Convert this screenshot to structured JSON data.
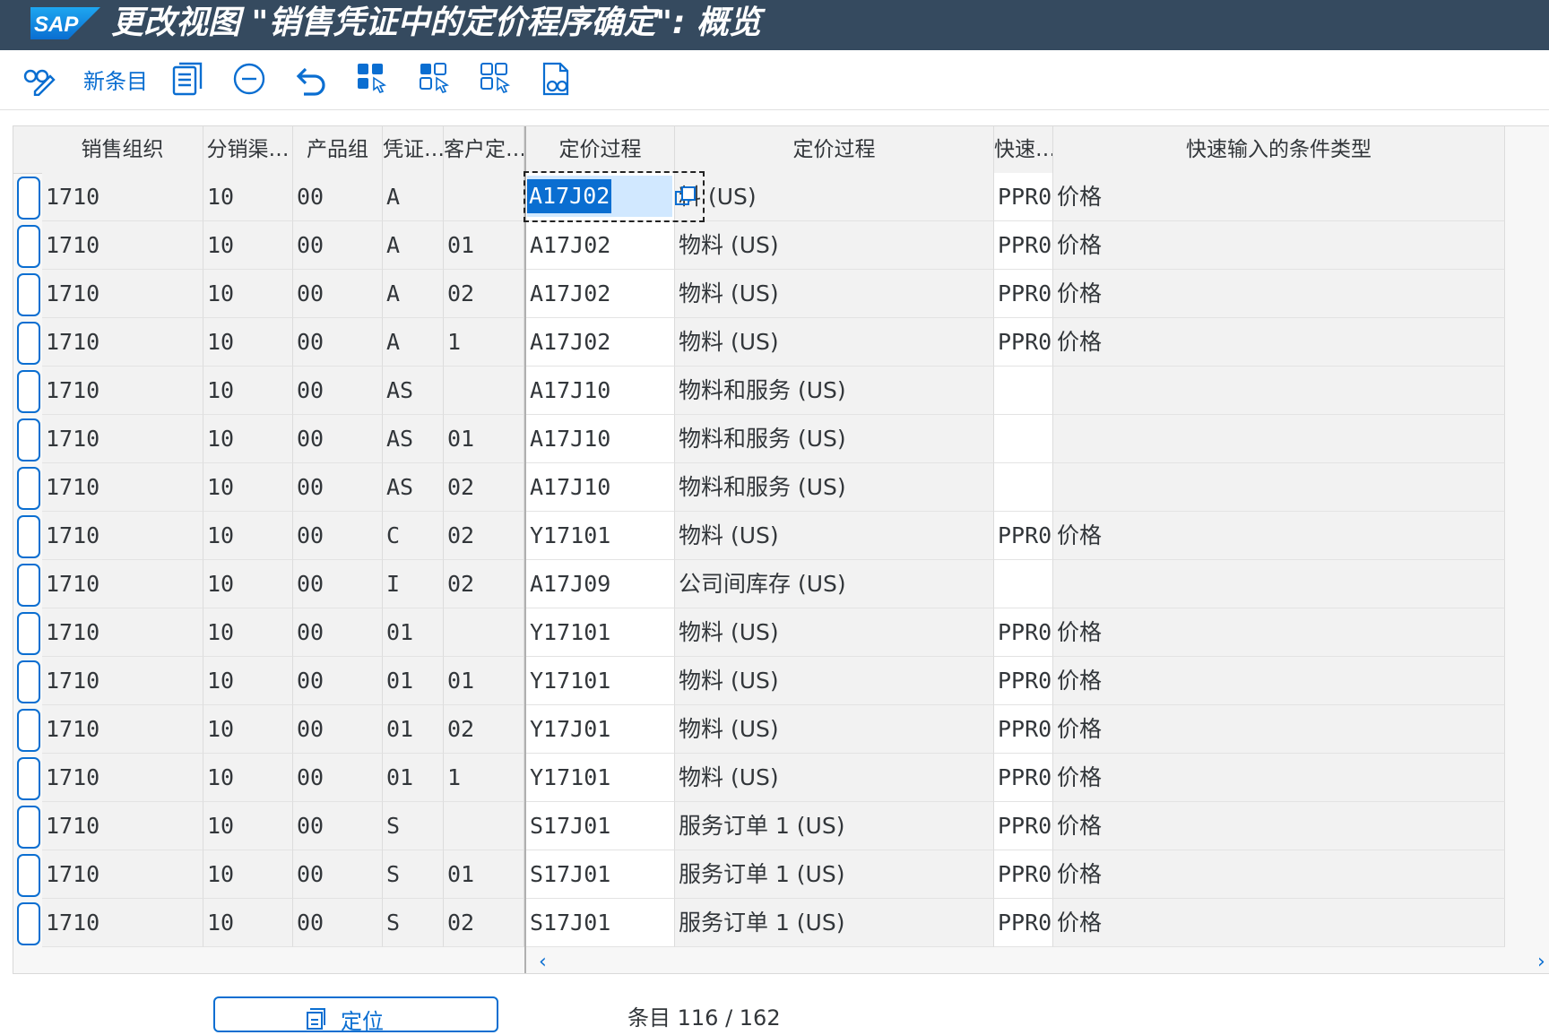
{
  "titlebar": {
    "logo_text": "SAP",
    "title": "更改视图 \"销售凭证中的定价程序确定\": 概览"
  },
  "toolbar": {
    "items": [
      {
        "name": "display-change-button",
        "icon": "glasses-pencil-icon"
      },
      {
        "name": "new-entries-button",
        "label": "新条目"
      },
      {
        "name": "copy-as-button",
        "icon": "copy-document-icon"
      },
      {
        "name": "delete-button",
        "icon": "minus-circle-icon"
      },
      {
        "name": "undo-button",
        "icon": "undo-icon"
      },
      {
        "name": "select-all-button",
        "icon": "select-all-icon"
      },
      {
        "name": "select-block-button",
        "icon": "select-block-icon"
      },
      {
        "name": "deselect-all-button",
        "icon": "deselect-all-icon"
      },
      {
        "name": "print-preview-button",
        "icon": "print-preview-icon"
      }
    ]
  },
  "table": {
    "headers": [
      "销售组织",
      "分销渠…",
      "产品组",
      "凭证…",
      "客户定…",
      "定价过程",
      "定价过程",
      "快速…",
      "快速输入的条件类型"
    ],
    "rows": [
      [
        "1710",
        "10",
        "00",
        "A",
        "",
        "A17J02",
        "料 (US)",
        "PPR0",
        "价格"
      ],
      [
        "1710",
        "10",
        "00",
        "A",
        "01",
        "A17J02",
        "物料 (US)",
        "PPR0",
        "价格"
      ],
      [
        "1710",
        "10",
        "00",
        "A",
        "02",
        "A17J02",
        "物料 (US)",
        "PPR0",
        "价格"
      ],
      [
        "1710",
        "10",
        "00",
        "A",
        "1",
        "A17J02",
        "物料 (US)",
        "PPR0",
        "价格"
      ],
      [
        "1710",
        "10",
        "00",
        "AS",
        "",
        "A17J10",
        "物料和服务 (US)",
        "",
        ""
      ],
      [
        "1710",
        "10",
        "00",
        "AS",
        "01",
        "A17J10",
        "物料和服务 (US)",
        "",
        ""
      ],
      [
        "1710",
        "10",
        "00",
        "AS",
        "02",
        "A17J10",
        "物料和服务 (US)",
        "",
        ""
      ],
      [
        "1710",
        "10",
        "00",
        "C",
        "02",
        "Y17101",
        "物料 (US)",
        "PPR0",
        "价格"
      ],
      [
        "1710",
        "10",
        "00",
        "I",
        "02",
        "A17J09",
        "公司间库存 (US)",
        "",
        ""
      ],
      [
        "1710",
        "10",
        "00",
        "01",
        "",
        "Y17101",
        "物料 (US)",
        "PPR0",
        "价格"
      ],
      [
        "1710",
        "10",
        "00",
        "01",
        "01",
        "Y17101",
        "物料 (US)",
        "PPR0",
        "价格"
      ],
      [
        "1710",
        "10",
        "00",
        "01",
        "02",
        "Y17J01",
        "物料 (US)",
        "PPR0",
        "价格"
      ],
      [
        "1710",
        "10",
        "00",
        "01",
        "1",
        "Y17101",
        "物料 (US)",
        "PPR0",
        "价格"
      ],
      [
        "1710",
        "10",
        "00",
        "S",
        "",
        "S17J01",
        "服务订单 1 (US)",
        "PPR0",
        "价格"
      ],
      [
        "1710",
        "10",
        "00",
        "S",
        "01",
        "S17J01",
        "服务订单 1 (US)",
        "PPR0",
        "价格"
      ],
      [
        "1710",
        "10",
        "00",
        "S",
        "02",
        "S17J01",
        "服务订单 1 (US)",
        "PPR0",
        "价格"
      ]
    ],
    "selected_value": "A17J02"
  },
  "footer": {
    "position_label": "定位",
    "entry_text": "条目 116 / 162"
  },
  "colors": {
    "titlebar": "#354a5f",
    "accent": "#0a6ed1"
  }
}
